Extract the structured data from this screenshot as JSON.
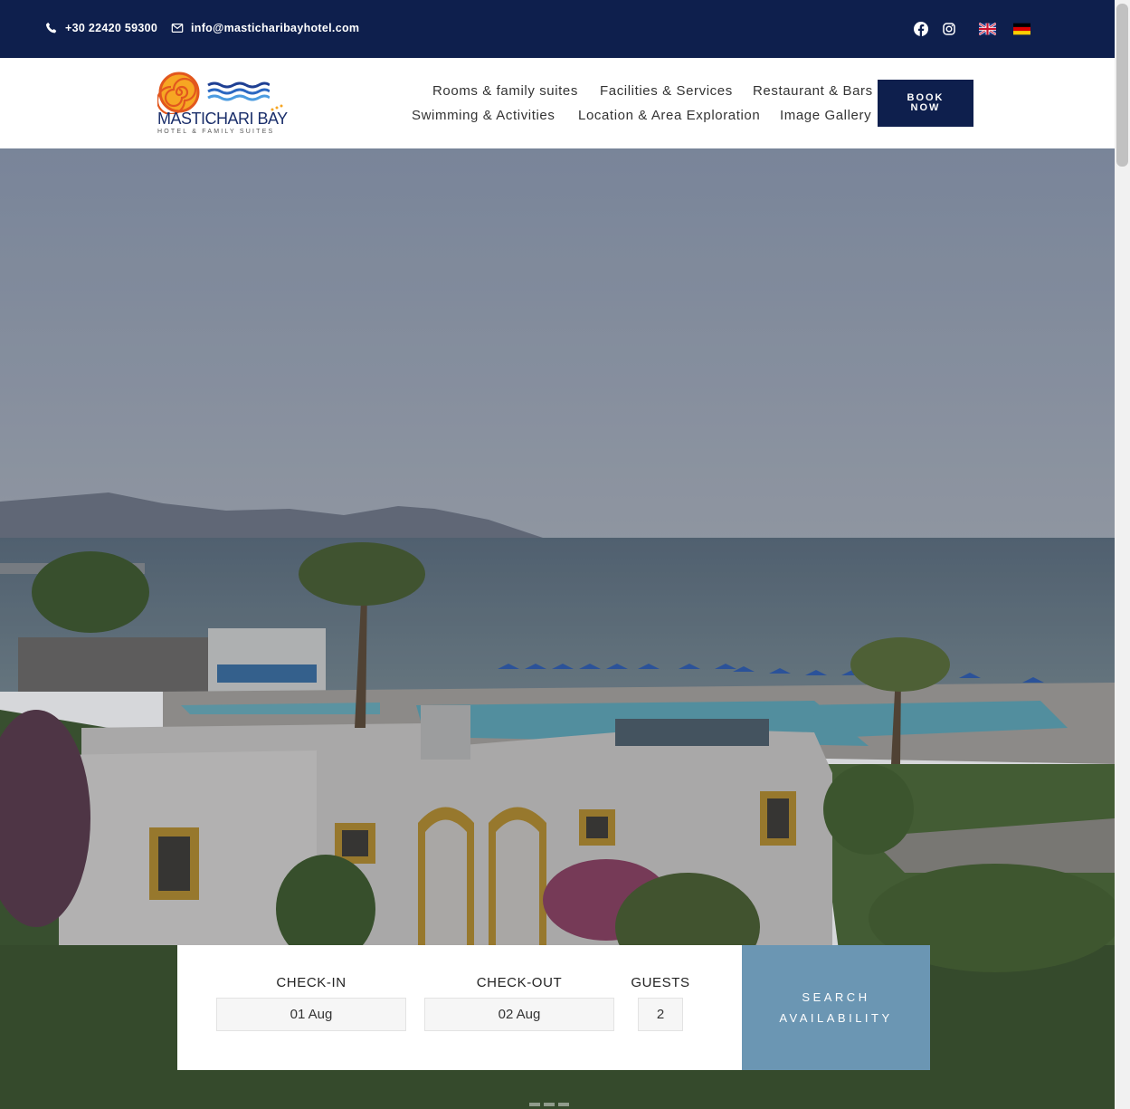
{
  "topbar": {
    "phone": "+30 22420 59300",
    "email": "info@masticharibayhotel.com",
    "social": [
      "facebook-icon",
      "instagram-icon"
    ],
    "languages": [
      "english-flag",
      "german-flag"
    ],
    "bg_color": "#0e1f4d"
  },
  "logo": {
    "title": "MASTICHARI BAY",
    "subtitle": "HOTEL & FAMILY SUITES"
  },
  "nav": {
    "row1": [
      "Rooms & family suites",
      "Facilities & Services",
      "Restaurant & Bars"
    ],
    "row2": [
      "Swimming & Activities",
      "Location & Area Exploration",
      "Image Gallery"
    ],
    "book_line1": "BOOK",
    "book_line2": "NOW"
  },
  "booking": {
    "checkin_label": "CHECK-IN",
    "checkin_value": "01 Aug",
    "checkout_label": "CHECK-OUT",
    "checkout_value": "02 Aug",
    "guests_label": "GUESTS",
    "guests_value": "2",
    "search_line1": "SEARCH",
    "search_line2": "AVAILABILITY",
    "search_color": "#6b96b3"
  }
}
